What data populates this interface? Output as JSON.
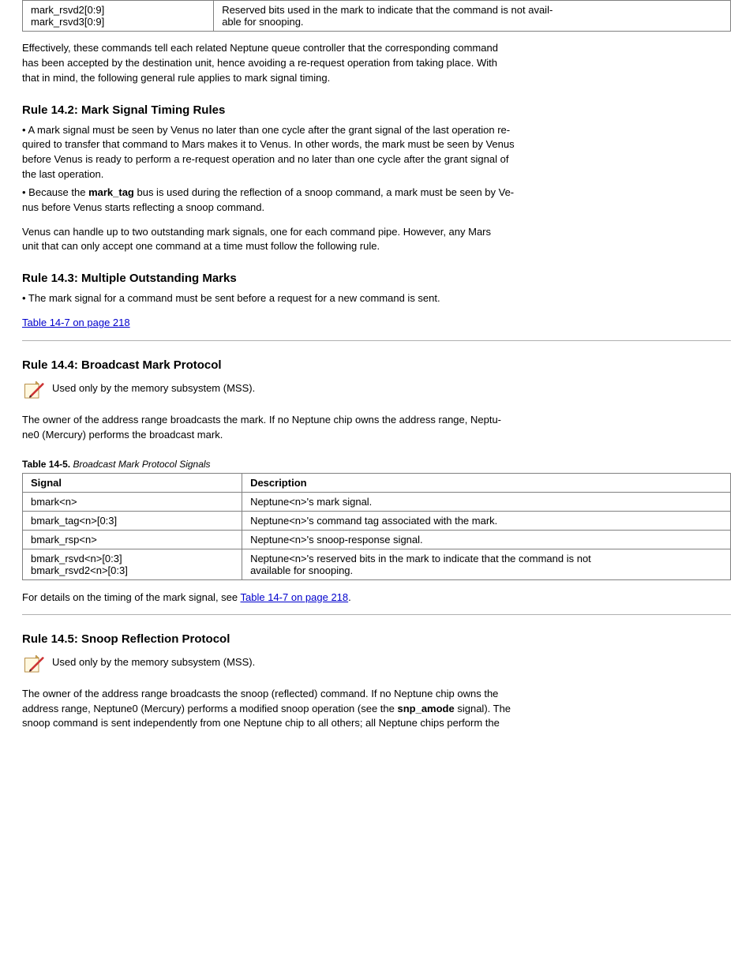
{
  "table1": {
    "row": {
      "c0_label": "mark_rsvd2[0:9]",
      "c0_label2": "mark_rsvd3[0:9]",
      "c1": "Reserved bits used in the mark to indicate that the command is not avail-\nable for snooping."
    }
  },
  "para1": "Effectively, these commands tell each related Neptune queue controller that the corresponding command\nhas been accepted by the destination unit, hence avoiding a re-request operation from taking place. With\nthat in mind, the following general rule applies to mark signal timing.",
  "rule1": {
    "title": "Rule 14.2: Mark Signal Timing Rules",
    "bullet1": "•   A mark signal must be seen by Venus no later than one cycle after the grant signal of the last operation re-\nquired to transfer that command to Mars makes it to Venus. In other words, the mark must be seen by Venus\nbefore Venus is ready to perform a re-request operation and no later than one cycle after the grant signal of\nthe last operation.",
    "bullet2_a": "•   Because the ",
    "bullet2_code": "mark_tag",
    "bullet2_b": " bus is used during the reflection of a snoop command, a mark must be seen by Ve-\nnus before Venus starts reflecting a snoop command.",
    "para": "Venus can handle up to two outstanding mark signals, one for each command pipe. However, any Mars\nunit that can only accept one command at a time must follow the following rule.",
    "subtitle": "Rule 14.3: Multiple Outstanding Marks",
    "bullet3": "•   The mark signal for a command must be sent before a request for a new command is sent.",
    "link": "Table 14-7 on page 218"
  },
  "section2": {
    "heading": "Rule 14.4: Broadcast Mark Protocol",
    "note": "Used only by the memory subsystem (MSS).",
    "para": "The owner of the address range broadcasts the mark. If no Neptune chip owns the address range, Neptu-\nne0 (Mercury) performs the broadcast mark.",
    "caption_bold": "Table 14-5.",
    "caption_rest": " Broadcast Mark Protocol Signals ",
    "table": {
      "header": {
        "c0": "Signal",
        "c1": "Description"
      },
      "rows": [
        {
          "c0": "bmark<n>",
          "c1": "Neptune<n>'s mark signal."
        },
        {
          "c0": "bmark_tag<n>[0:3]",
          "c1": "Neptune<n>'s command tag associated with the mark."
        },
        {
          "c0": "bmark_rsp<n>",
          "c1": "Neptune<n>'s snoop-response signal."
        },
        {
          "c0_a": "bmark_rsvd<n>[0:3]",
          "c0_b": "bmark_rsvd2<n>[0:3]",
          "c1": "Neptune<n>'s reserved bits in the mark to indicate that the command is not\navailable for snooping."
        }
      ]
    },
    "footer_a": "For details on the timing of the mark signal, see ",
    "footer_link": "Table 14-7 on page 218",
    "footer_b": "."
  },
  "section3": {
    "heading": "Rule 14.5: Snoop Reflection Protocol",
    "note": "Used only by the memory subsystem (MSS).",
    "para_a": "The owner of the address range broadcasts the snoop (reflected) command. If no Neptune chip owns the\naddress range, Neptune0 (Mercury) performs a modified snoop operation (see the ",
    "para_code": "snp_amode",
    "para_b": " signal). The\nsnoop command is sent independently from one Neptune chip to all others; all Neptune chips perform the"
  }
}
